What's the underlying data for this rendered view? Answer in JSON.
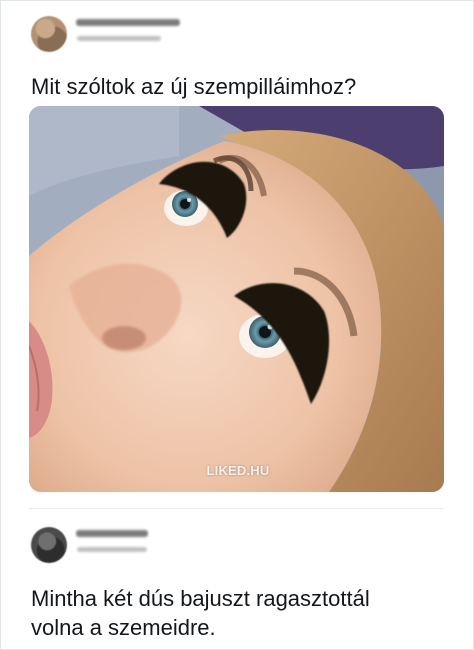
{
  "tweet1": {
    "text": "Mit szóltok az új szempilláimhoz?",
    "photo": {
      "watermark": "LIKED.HU",
      "colors": {
        "skin": "#f0c9b0",
        "hair": "#c99a68",
        "lashes": "#1c1410",
        "iris": "#5e8e9e",
        "lips": "#d88b86",
        "blanket_gray": "#9aa6b8",
        "blanket_purple": "#4b3d6a"
      }
    }
  },
  "tweet2": {
    "text": "Mintha két dús bajuszt ragasztottál\nvolna a szemeidre."
  }
}
